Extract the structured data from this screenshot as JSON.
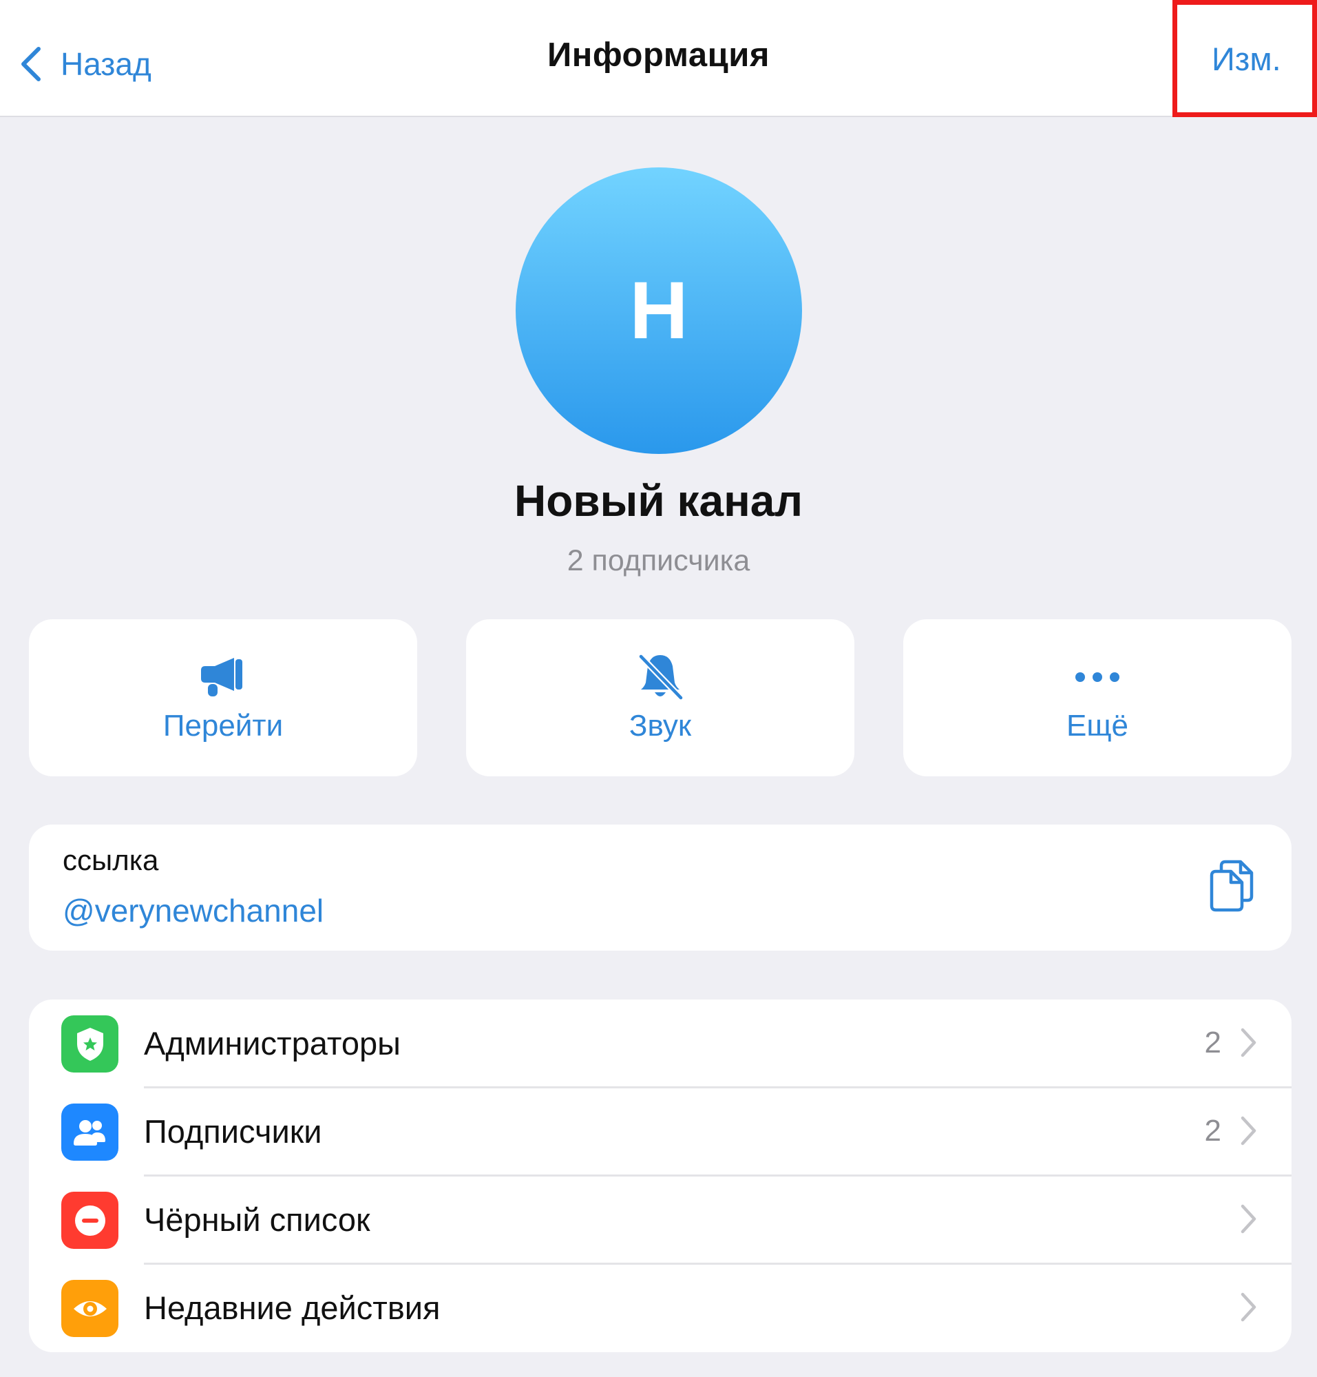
{
  "nav": {
    "back_label": "Назад",
    "title": "Информация",
    "edit_label": "Изм."
  },
  "profile": {
    "avatar_letter": "Н",
    "name": "Новый канал",
    "subscribers": "2 подписчика"
  },
  "actions": [
    {
      "label": "Перейти",
      "icon": "megaphone-icon"
    },
    {
      "label": "Звук",
      "icon": "bell-slash-icon"
    },
    {
      "label": "Ещё",
      "icon": "ellipsis-icon"
    }
  ],
  "link": {
    "caption": "ссылка",
    "value": "@verynewchannel",
    "icon": "copy-icon"
  },
  "menu": [
    {
      "label": "Администраторы",
      "count": "2",
      "icon": "shield-star-icon",
      "color": "#34c759"
    },
    {
      "label": "Подписчики",
      "count": "2",
      "icon": "people-icon",
      "color": "#1e88ff"
    },
    {
      "label": "Чёрный список",
      "count": "",
      "icon": "blocked-icon",
      "color": "#ff3b30"
    },
    {
      "label": "Недавние действия",
      "count": "",
      "icon": "eye-icon",
      "color": "#ff9f0a"
    }
  ],
  "colors": {
    "accent": "#2f86d8",
    "background": "#efeff4",
    "highlight": "#ee1b1b"
  }
}
